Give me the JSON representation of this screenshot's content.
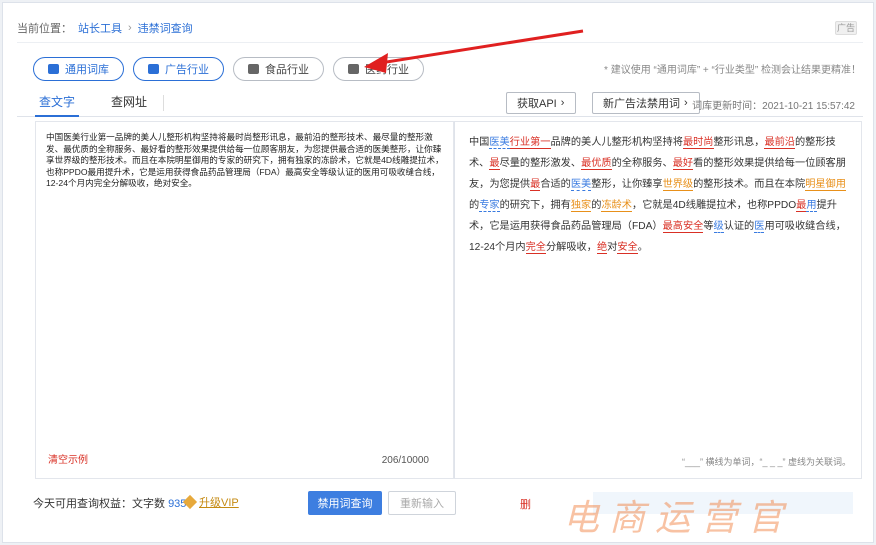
{
  "breadcrumb": {
    "prefix": "当前位置：",
    "items": [
      "站长工具",
      "违禁词查询"
    ],
    "separator": "›",
    "tag": "广告"
  },
  "industries": [
    {
      "label": "通用词库",
      "icon": "book-icon",
      "style": "blue"
    },
    {
      "label": "广告行业",
      "icon": "monitor-icon",
      "style": "blue"
    },
    {
      "label": "食品行业",
      "icon": "food-icon",
      "style": "gray"
    },
    {
      "label": "医药行业",
      "icon": "medicine-icon",
      "style": "gray"
    }
  ],
  "hint": "* 建议使用 “通用词库” + “行业类型” 检测会让结果更精准！",
  "tabs": {
    "text": "查文字",
    "url": "查网址"
  },
  "toolbar": {
    "api_label": "获取API",
    "new_law_label": "新广告法禁用词",
    "update_time": "词库更新时间：2021-10-21 15:57:42"
  },
  "source_text": "中国医美行业第一品牌的美人儿整形机构坚持将最时尚整形讯息，最前沿的整形技术、最尽量的整形激发、最优质的全称服务、最好看的整形效果提供给每一位顾客朋友，为您提供最合适的医美整形，让你臻享世界级的整形技术。而且在本院明星御用的专家的研究下，拥有独家的冻龄术，它就是4D线雕提拉术，也称PPDO最用提升术，它是运用获得食品药品管理局（FDA）最高安全等级认证的医用可吸收缝合线，12-24个月内完全分解吸收，绝对安全。",
  "result_segments": [
    {
      "t": "中国"
    },
    {
      "t": "医美",
      "c": "blue"
    },
    {
      "t": "行业第一",
      "c": "red"
    },
    {
      "t": "品牌的美人儿整形机构坚持将"
    },
    {
      "t": "最时尚",
      "c": "red"
    },
    {
      "t": "整形讯息，"
    },
    {
      "t": "最前沿",
      "c": "red"
    },
    {
      "t": "的整形技术、"
    },
    {
      "t": "最",
      "c": "red"
    },
    {
      "t": "尽量的整形激发、"
    },
    {
      "t": "最优质",
      "c": "red"
    },
    {
      "t": "的全称服务、"
    },
    {
      "t": "最好",
      "c": "red"
    },
    {
      "t": "看的整形效果提供给每一位顾客朋友，为您提供"
    },
    {
      "t": "最",
      "c": "red"
    },
    {
      "t": "合适的"
    },
    {
      "t": "医美",
      "c": "blue"
    },
    {
      "t": "整形，让你臻享"
    },
    {
      "t": "世界级",
      "c": "orange"
    },
    {
      "t": "的整形技术。而且在本院"
    },
    {
      "t": "明星御用",
      "c": "orange"
    },
    {
      "t": "的"
    },
    {
      "t": "专家",
      "c": "blue"
    },
    {
      "t": "的研究下，拥有"
    },
    {
      "t": "独家",
      "c": "orange"
    },
    {
      "t": "的"
    },
    {
      "t": "冻龄术",
      "c": "orange"
    },
    {
      "t": "，它就是4D线雕提拉术，也称PPDO"
    },
    {
      "t": "最",
      "c": "red"
    },
    {
      "t": "用",
      "c": "blue"
    },
    {
      "t": "提升术，它是运用获得食品药品管理局（FDA）"
    },
    {
      "t": "最高",
      "c": "red"
    },
    {
      "t": "安全",
      "c": "red"
    },
    {
      "t": "等"
    },
    {
      "t": "级",
      "c": "blue"
    },
    {
      "t": "认证的"
    },
    {
      "t": "医",
      "c": "blue"
    },
    {
      "t": "用可吸收缝合线，12-24个月内"
    },
    {
      "t": "完全",
      "c": "red"
    },
    {
      "t": "分解吸收，"
    },
    {
      "t": "绝",
      "c": "red"
    },
    {
      "t": "对"
    },
    {
      "t": "安全",
      "c": "red"
    },
    {
      "t": "。"
    }
  ],
  "left_panel": {
    "clear_example": "清空示例",
    "counter": "206/10000"
  },
  "right_panel": {
    "legend_note": "“___” 横线为单词，“_ _ _” 虚线为关联词。"
  },
  "bottom": {
    "quota_label": "今天可用查询权益：文字数",
    "quota_value": "935",
    "vip_label": "升级VIP",
    "query_button": "禁用词查询",
    "reset_button": "重新输入",
    "right_link": "删"
  },
  "watermark": "电商运营官",
  "colors": {
    "accent": "#2b6fd6",
    "forbidden": "#d93025",
    "warning": "#e8901a",
    "related": "#3a7be0",
    "arrow": "#e02020"
  }
}
